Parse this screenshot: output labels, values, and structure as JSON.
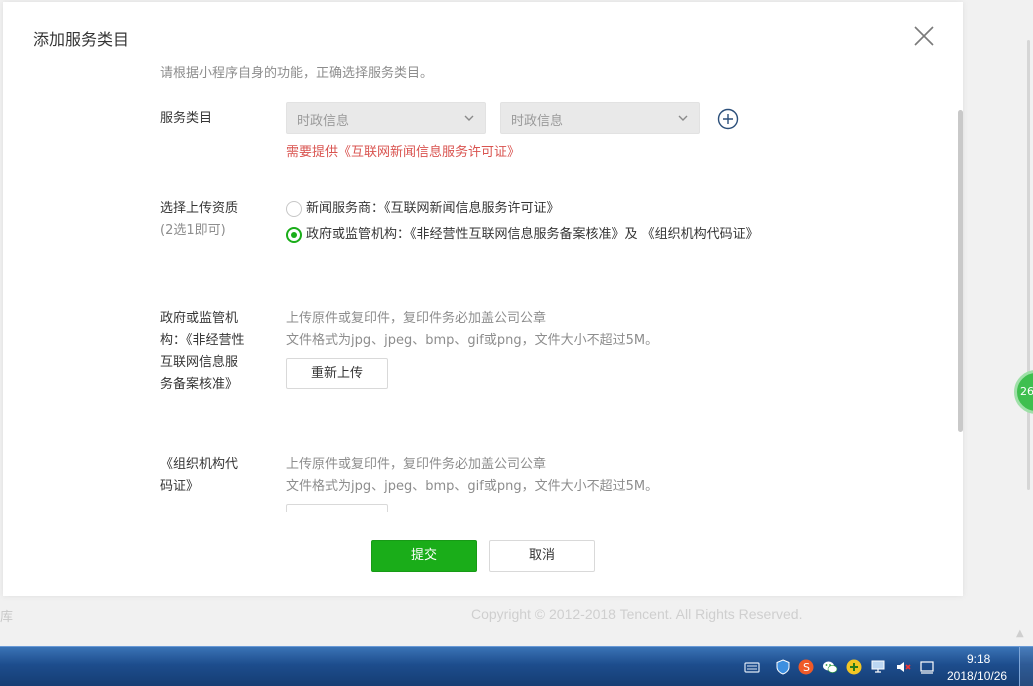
{
  "background": {
    "left_text": "库",
    "copyright": "Copyright © 2012-2018 Tencent. All Rights Reserved.",
    "float_badge": "26"
  },
  "dialog": {
    "title": "添加服务类目",
    "hint": "请根据小程序自身的功能，正确选择服务类目。",
    "service_category": {
      "label": "服务类目",
      "select1": "时政信息",
      "select2": "时政信息",
      "warning": "需要提供《互联网新闻信息服务许可证》"
    },
    "qualification": {
      "label": "选择上传资质",
      "sub_label": "(2选1即可)",
      "options": [
        {
          "text": "新闻服务商：《互联网新闻信息服务许可证》",
          "checked": false
        },
        {
          "text": "政府或监管机构：《非经营性互联网信息服务备案核准》及 《组织机构代码证》",
          "checked": true
        }
      ]
    },
    "upload1": {
      "label": "政府或监管机构：《非经营性互联网信息服务备案核准》",
      "note1": "上传原件或复印件，复印件务必加盖公司公章",
      "note2": "文件格式为jpg、jpeg、bmp、gif或png，文件大小不超过5M。",
      "button": "重新上传"
    },
    "upload2": {
      "label": "《组织机构代码证》",
      "note1": "上传原件或复印件，复印件务必加盖公司公章",
      "note2": "文件格式为jpg、jpeg、bmp、gif或png，文件大小不超过5M。"
    },
    "submit": "提交",
    "cancel": "取消"
  },
  "taskbar": {
    "time": "9:18",
    "date": "2018/10/26",
    "tray_icons": [
      "keyboard-icon",
      "shield-icon",
      "sogou-icon",
      "wechat-icon",
      "plus-icon",
      "network-icon",
      "volume-mute-icon",
      "action-center-icon"
    ]
  },
  "colors": {
    "primary": "#1aad19",
    "warning": "#d9534f",
    "taskbar": "#1d4d8d"
  }
}
